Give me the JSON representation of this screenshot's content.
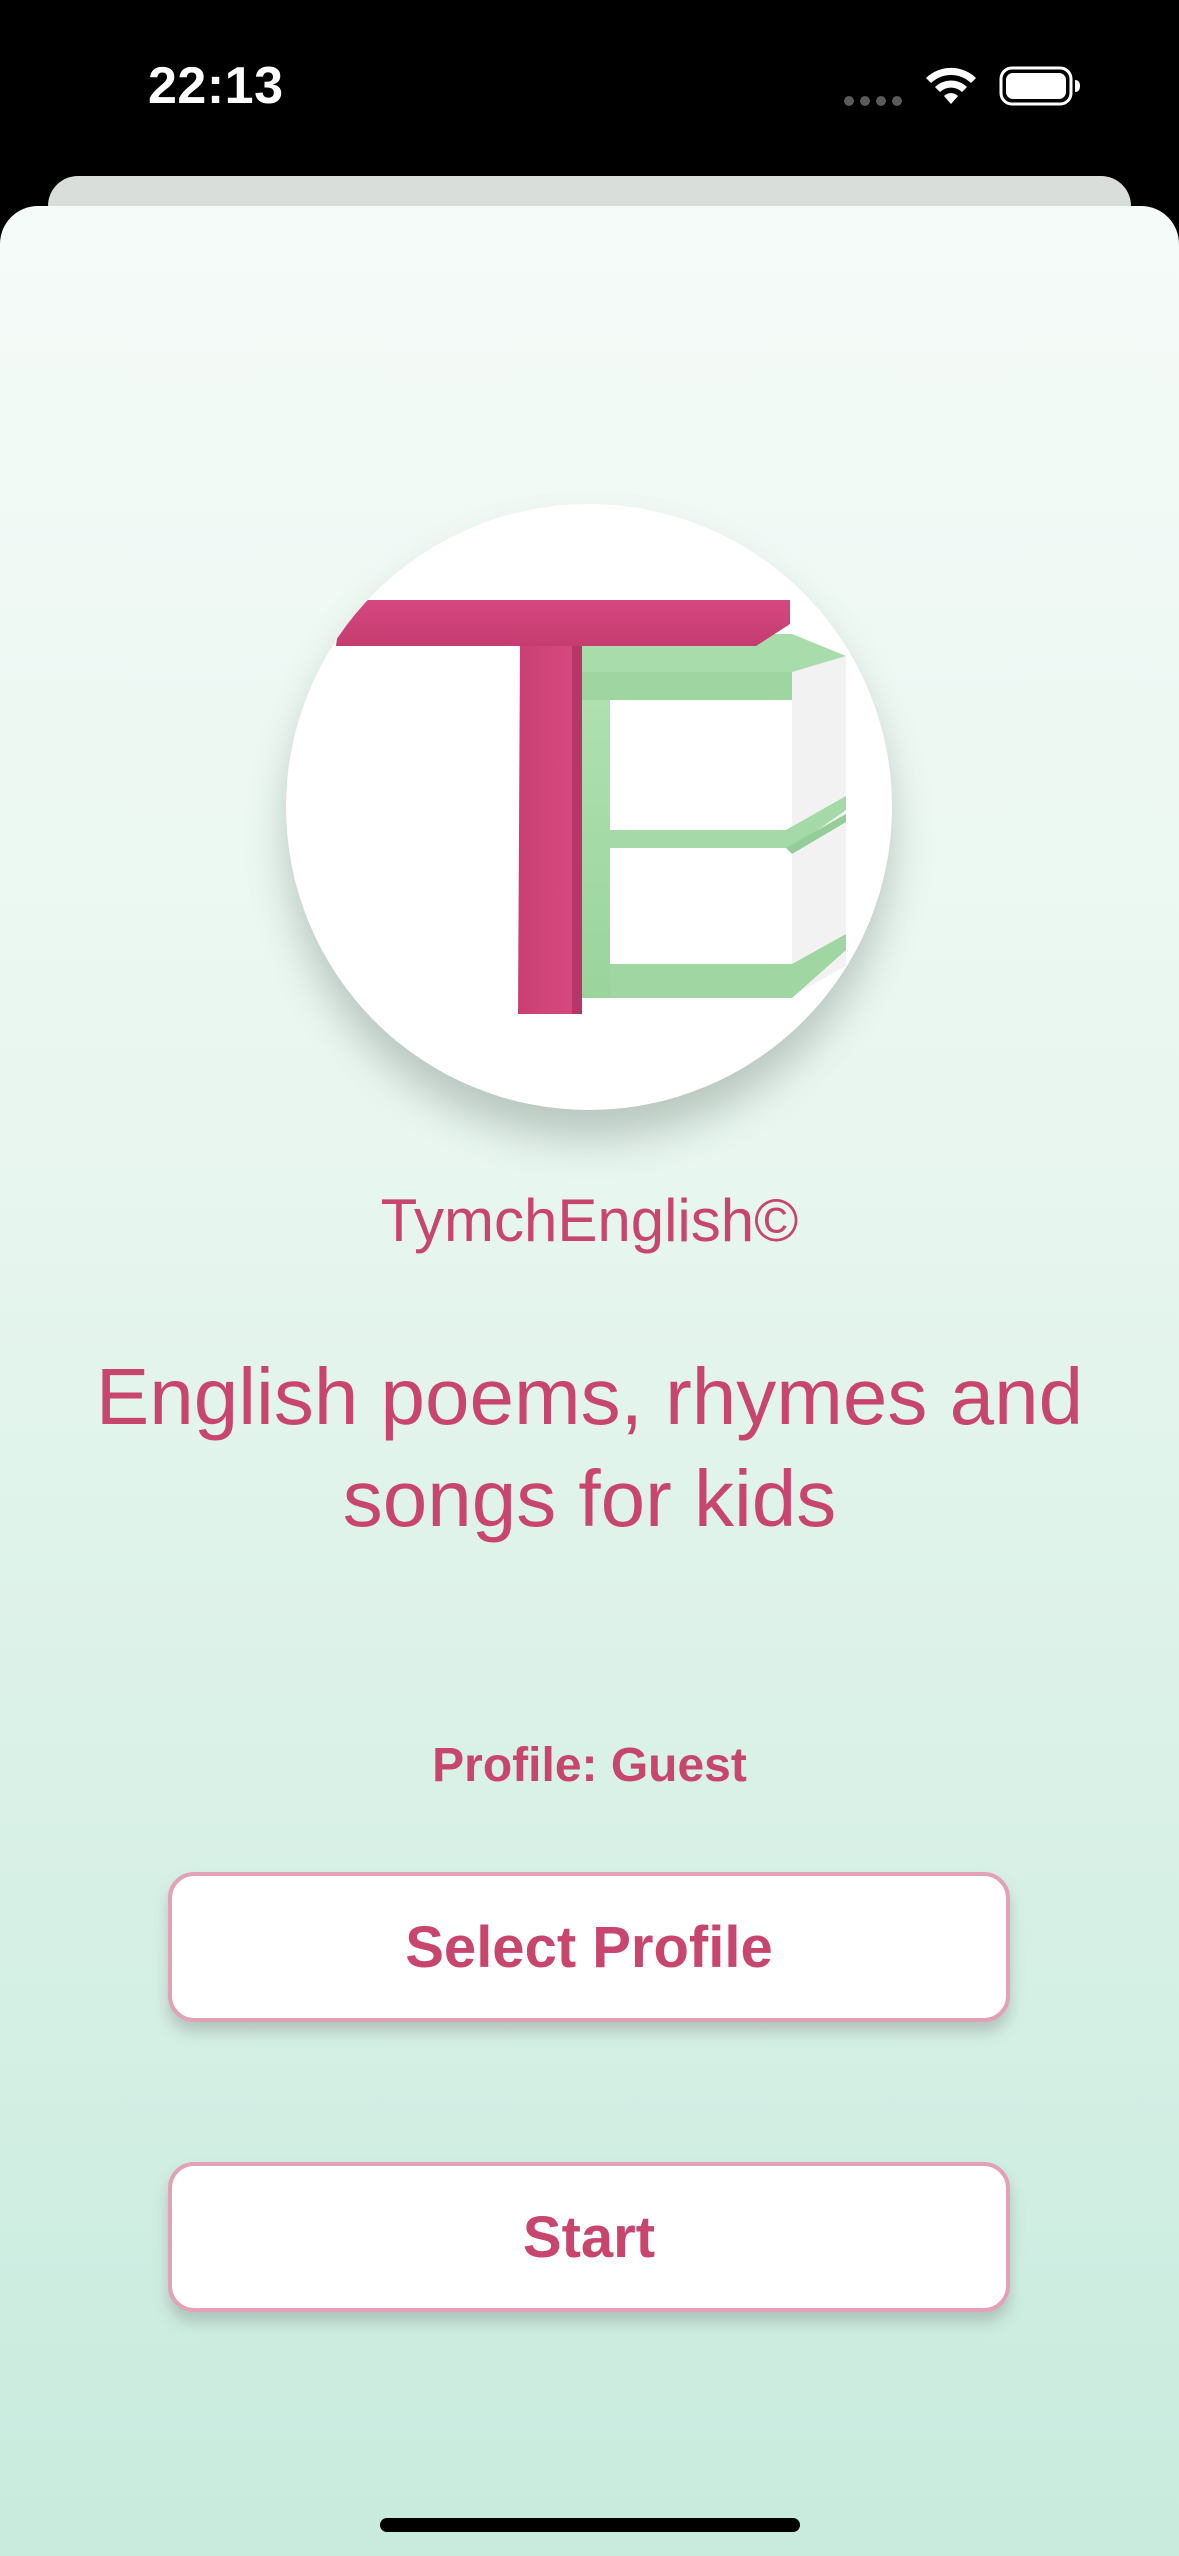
{
  "status_bar": {
    "time": "22:13",
    "icons": [
      "cellular-dots-icon",
      "wifi-icon",
      "battery-icon"
    ]
  },
  "logo": {
    "letters": "TE",
    "colors": {
      "t": "#cf3f76",
      "e": "#a3d9a5"
    }
  },
  "app_name": "TymchEnglish©",
  "tagline": "English poems, rhymes and songs for kids",
  "profile": {
    "label": "Profile: Guest"
  },
  "buttons": {
    "select_profile": "Select Profile",
    "start": "Start"
  },
  "colors": {
    "accent": "#c8456e",
    "button_border": "#e2a1b6",
    "background_top": "#f5fbf8",
    "background_bottom": "#c8ebde"
  }
}
